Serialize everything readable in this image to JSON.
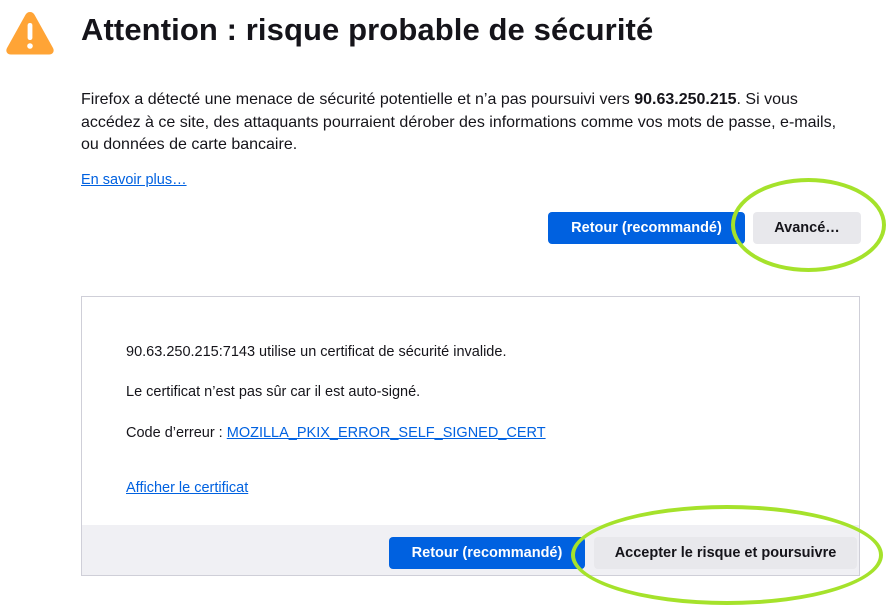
{
  "header": {
    "title": "Attention : risque probable de sécurité",
    "warning_icon": "warning-triangle-icon"
  },
  "intro": {
    "text_before": "Firefox a détecté une menace de sécurité potentielle et n’a pas poursuivi vers ",
    "host": "90.63.250.215",
    "text_after": ". Si vous accédez à ce site, des attaquants pourraient dérober des informations comme vos mots de passe, e-mails, ou données de carte bancaire."
  },
  "learn_more_label": "En savoir plus…",
  "buttons": {
    "back_label": "Retour (recommandé)",
    "advanced_label": "Avancé…",
    "accept_label": "Accepter le risque et poursuivre"
  },
  "advanced": {
    "invalid_cert_text": "90.63.250.215:7143 utilise un certificat de sécurité invalide.",
    "self_signed_text": "Le certificat n’est pas sûr car il est auto-signé.",
    "error_code_label": "Code d’erreur : ",
    "error_code": "MOZILLA_PKIX_ERROR_SELF_SIGNED_CERT",
    "view_cert_label": "Afficher le certificat"
  },
  "colors": {
    "primary_button": "#0061e0",
    "secondary_button": "#e8e8ec",
    "warning": "#ffa436",
    "highlight_ring": "#a5e22b",
    "link": "#0061e0"
  }
}
